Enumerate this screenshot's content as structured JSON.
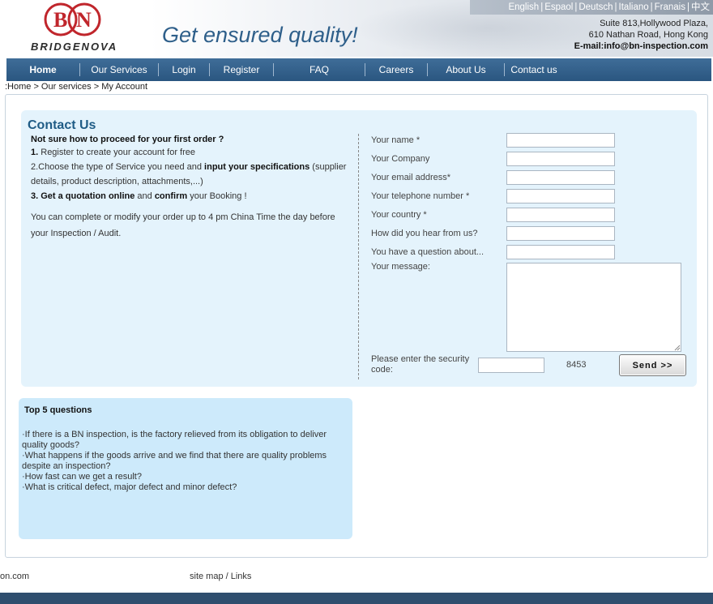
{
  "header": {
    "languages": [
      "English",
      "Espaol",
      "Deutsch",
      "Italiano",
      "Franais",
      "中文"
    ],
    "logo_text": "BRIDGENOVA",
    "logo_letters": "BN",
    "tagline": "Get ensured quality!",
    "address_line1": "Suite 813,Hollywood Plaza,",
    "address_line2": "610 Nathan Road, Hong Kong",
    "email": "E-mail:info@bn-inspection.com"
  },
  "nav": {
    "items": [
      "Home",
      "Our Services",
      "Login",
      "Register",
      "FAQ",
      "Careers",
      "About Us",
      "Contact us"
    ],
    "active": "Home"
  },
  "breadcrumb": ":Home > Our services > My Account",
  "contact": {
    "title": "Contact Us",
    "question": "Not sure how to proceed for your first order ?",
    "step1_num": "1.",
    "step1_text": " Register to create your account for free",
    "step2_a": "2.Choose the type of Service you need and ",
    "step2_b": "input your specifications",
    "step2_c": " (supplier details, product description, attachments,...)",
    "step3_num": "3. ",
    "step3_a": "Get a quotation online",
    "step3_b": " and ",
    "step3_c": "confirm",
    "step3_d": " your Booking !",
    "note": "You can complete or modify your order up to 4 pm China Time the day before your Inspection / Audit."
  },
  "form": {
    "labels": {
      "name": "Your name *",
      "company": "Your Company",
      "email": "Your email address*",
      "phone": "Your telephone number *",
      "country": "Your country *",
      "hear": "How did you hear from us?",
      "question": "You have a question about...",
      "message": "Your message:"
    },
    "values": {
      "name": "",
      "company": "",
      "email": "",
      "phone": "",
      "country": "",
      "hear": "",
      "question": "",
      "message": ""
    },
    "security_label": "Please enter the security code:",
    "security_value": "",
    "security_code": "8453",
    "send_label": "Send >>"
  },
  "faq": {
    "title": "Top 5 questions",
    "items": [
      "·If there is a BN inspection, is the factory relieved from its obligation to deliver quality goods?",
      "·What happens if the goods arrive and we find that there are quality problems despite an inspection?",
      "·How fast can we get a result?",
      "·What is critical defect, major defect and minor defect?"
    ]
  },
  "footer": {
    "left": "on.com",
    "links": "site map / Links"
  },
  "colors": {
    "nav_bg": "#2f5b85",
    "title_blue": "#1f5c86",
    "contact_bg": "#e4f3fc",
    "faq_bg": "#cdeafb",
    "logo_red": "#c0262c"
  }
}
